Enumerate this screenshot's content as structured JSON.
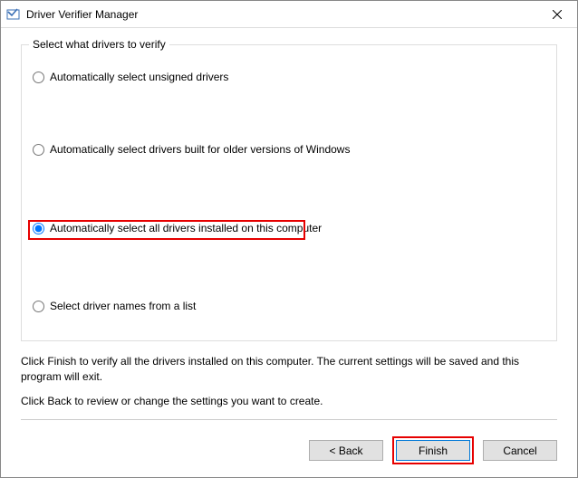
{
  "window": {
    "title": "Driver Verifier Manager"
  },
  "fieldset": {
    "legend": "Select what drivers to verify"
  },
  "options": {
    "opt0": {
      "label": "Automatically select unsigned drivers"
    },
    "opt1": {
      "label": "Automatically select drivers built for older versions of Windows"
    },
    "opt2": {
      "label": "Automatically select all drivers installed on this computer"
    },
    "opt3": {
      "label": "Select driver names from a list"
    }
  },
  "info": {
    "line1": "Click Finish to verify all the drivers installed on this computer. The current settings will be saved and this program will exit.",
    "line2": "Click Back to review or change the settings you want to create."
  },
  "buttons": {
    "back": "< Back",
    "finish": "Finish",
    "cancel": "Cancel"
  }
}
